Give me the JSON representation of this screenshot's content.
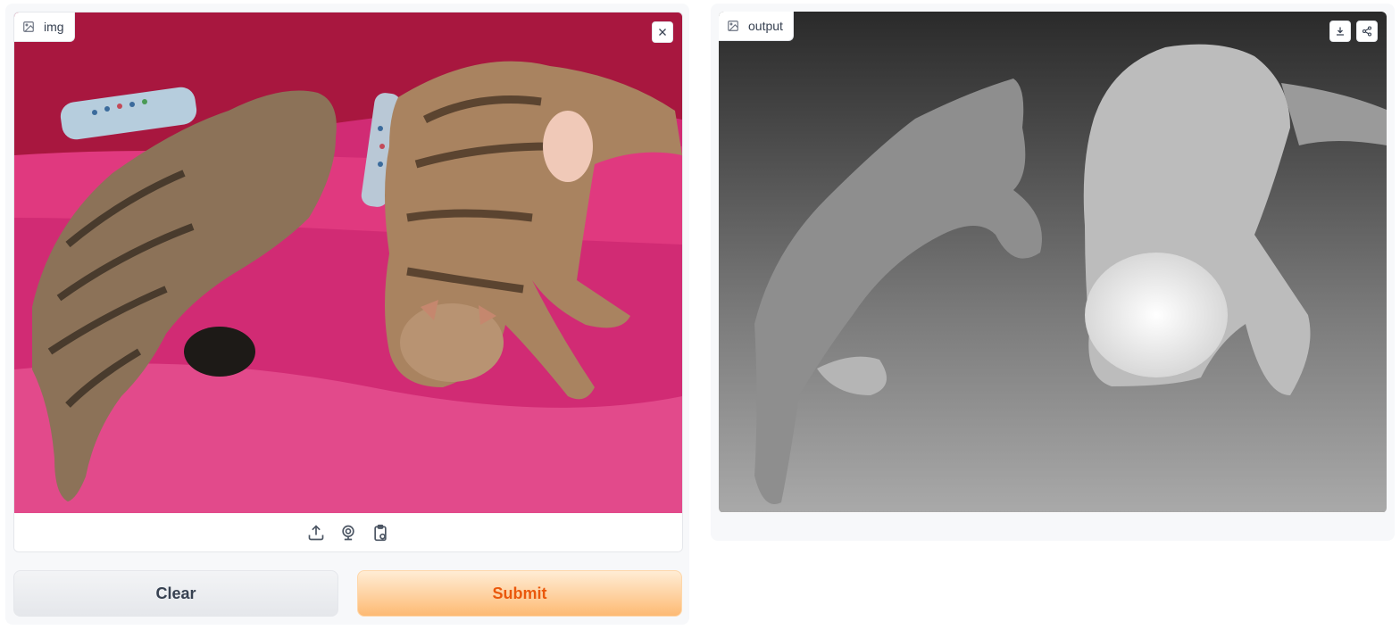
{
  "input": {
    "label": "img",
    "label_icon": "image-icon",
    "clear_icon": "close-icon",
    "toolbar": [
      {
        "name": "upload-icon"
      },
      {
        "name": "webcam-icon"
      },
      {
        "name": "clipboard-icon"
      }
    ]
  },
  "output": {
    "label": "output",
    "label_icon": "image-icon",
    "actions": [
      {
        "name": "download-icon"
      },
      {
        "name": "share-icon"
      }
    ]
  },
  "buttons": {
    "clear_label": "Clear",
    "submit_label": "Submit"
  },
  "colors": {
    "accent": "#ea580c",
    "accent_bg": "#fdba74",
    "blanket": "#d42a73"
  }
}
